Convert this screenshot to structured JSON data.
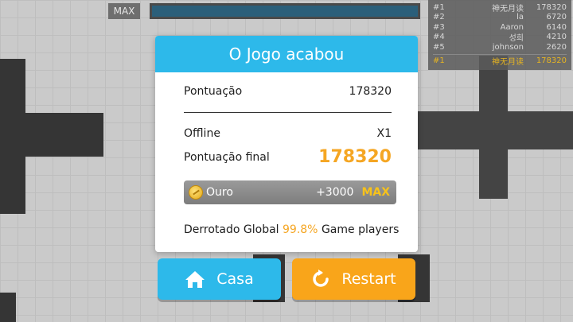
{
  "hud": {
    "max_label": "MAX"
  },
  "leaderboard": {
    "rows": [
      {
        "rank": "#1",
        "name": "神无月读",
        "score": "178320"
      },
      {
        "rank": "#2",
        "name": "la",
        "score": "6720"
      },
      {
        "rank": "#3",
        "name": "Aaron",
        "score": "6140"
      },
      {
        "rank": "#4",
        "name": "성희",
        "score": "4210"
      },
      {
        "rank": "#5",
        "name": "johnson",
        "score": "2620"
      }
    ],
    "self": {
      "rank": "#1",
      "name": "神无月读",
      "score": "178320"
    }
  },
  "modal": {
    "title": "O Jogo acabou",
    "score_label": "Pontuação",
    "score_value": "178320",
    "offline_label": "Offline",
    "offline_value": "X1",
    "final_label": "Pontuação final",
    "final_value": "178320",
    "gold_label": "Ouro",
    "gold_amount": "+3000",
    "gold_max": "MAX",
    "global_prefix": "Derrotado Global",
    "global_pct": "99.8%",
    "global_suffix": "Game players"
  },
  "buttons": {
    "home_label": "Casa",
    "restart_label": "Restart"
  },
  "colors": {
    "accent_blue": "#2db9ea",
    "accent_orange": "#f9a51a",
    "highlight_gold": "#f5a623"
  },
  "icons": {
    "home": "home-icon",
    "restart": "restart-icon",
    "coin": "coin-icon"
  }
}
